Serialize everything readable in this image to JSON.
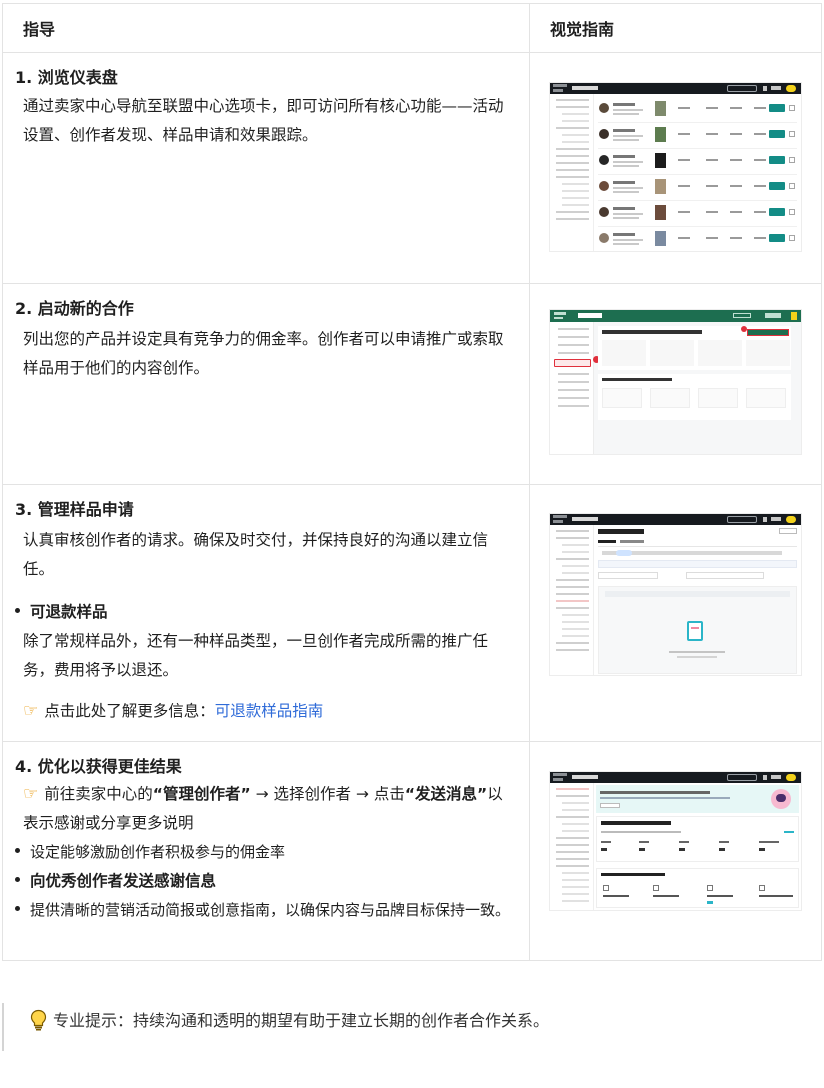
{
  "table": {
    "headers": {
      "guide": "指导",
      "visual": "视觉指南"
    },
    "steps": [
      {
        "title": "1. 浏览仪表盘",
        "text": "通过卖家中心导航至联盟中心选项卡，即可访问所有核心功能——活动设置、创作者发现、样品申请和效果跟踪。"
      },
      {
        "title": "2. 启动新的合作",
        "text": "列出您的产品并设定具有竞争力的佣金率。创作者可以申请推广或索取样品用于他们的内容创作。"
      },
      {
        "title": "3. 管理样品申请",
        "text": "认真审核创作者的请求。确保及时交付，并保持良好的沟通以建立信任。",
        "bullet_title": "可退款样品",
        "bullet_text": "除了常规样品外，还有一种样品类型，一旦创作者完成所需的推广任务，费用将予以退还。",
        "link_prefix": "点击此处了解更多信息：",
        "link_text": "可退款样品指南"
      },
      {
        "title": "4. 优化以获得更佳结果",
        "intro_a": "前往卖家中心的",
        "intro_b": "“管理创作者”",
        "intro_c": " → 选择创作者 → 点击",
        "intro_d": "“发送消息”",
        "intro_e": "以表示感谢或分享更多说明",
        "items": [
          "设定能够激励创作者积极参与的佣金率",
          "向优秀创作者发送感谢信息",
          "提供清晰的营销活动简报或创意指南，以确保内容与品牌目标保持一致。"
        ]
      }
    ]
  },
  "screenshots": {
    "dashboard": {
      "title": "Affiliate Center",
      "button": "Create messages",
      "help": "Help"
    },
    "collab": {
      "title": "Seller Center",
      "heading": "Hi Bagsuppil Selamat datang di TikTok Shop Affiliate",
      "cta": "Create open collaboration",
      "sub": "Promote your products with Affiliate",
      "brand_color": "#1d6e50"
    },
    "samples": {
      "title": "Affiliate Center",
      "heading": "Sample Requests",
      "tabs": [
        "Free samples",
        "Refundable samples"
      ],
      "empty": "There are no sample requests"
    },
    "optimize": {
      "title": "Affiliate Center",
      "heading": "Overview of your affiliate sales",
      "sub": "Items that need your attention"
    }
  },
  "pro_tip": "专业提示：持续沟通和透明的期望有助于建立长期的创作者合作关系。",
  "icons": {
    "hand": "pointing-hand-icon",
    "bulb": "lightbulb-icon"
  }
}
